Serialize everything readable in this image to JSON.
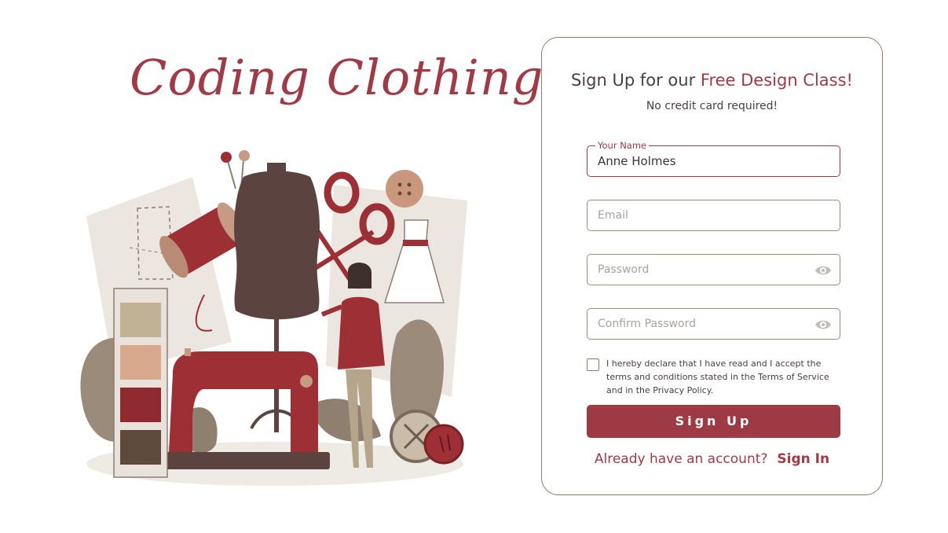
{
  "brand": {
    "title": "Coding Clothing"
  },
  "colors": {
    "accent": "#a23a46",
    "button": "#9e3a44",
    "border": "#8f7b6b",
    "text": "#4a4040"
  },
  "form": {
    "heading_prefix": "Sign Up for our ",
    "heading_accent": "Free Design Class!",
    "subheading": "No credit card required!",
    "name": {
      "label": "Your Name",
      "value": "Anne Holmes"
    },
    "email": {
      "placeholder": "Email"
    },
    "password": {
      "placeholder": "Password",
      "icon": "eye-icon"
    },
    "confirm_password": {
      "placeholder": "Confirm Password",
      "icon": "eye-icon"
    },
    "terms": {
      "checked": false,
      "text": "I hereby declare that I have read and I accept the terms and conditions stated in the Terms of Service and in the Privacy Policy."
    },
    "submit_label": "Sign Up",
    "signin_prompt": "Already have an account?",
    "signin_link": "Sign In"
  },
  "illustration": {
    "name": "sewing-illustration",
    "elements": [
      "dress-form",
      "sewing-machine",
      "scissors",
      "thread-spool",
      "pins",
      "buttons",
      "color-swatches",
      "dress",
      "woman-figure",
      "pattern-sheets",
      "leaves"
    ]
  }
}
